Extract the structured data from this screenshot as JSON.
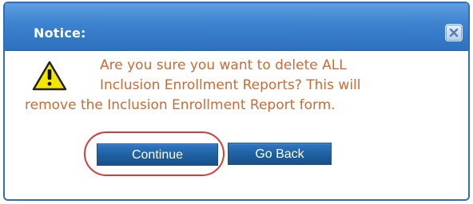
{
  "dialog": {
    "title": "Notice:",
    "close_icon": "close-icon",
    "warning_icon": "warning-icon",
    "message_lines": [
      "Are you sure you want to delete ALL",
      "Inclusion Enrollment Reports? This will",
      "remove the Inclusion Enrollment Report form."
    ],
    "continue_label": "Continue",
    "go_back_label": "Go Back"
  },
  "colors": {
    "title_bar": "#3b82cf",
    "message_text": "#cb6a35",
    "button_fill": "#1e5f9f",
    "highlight": "#d73a3a"
  }
}
